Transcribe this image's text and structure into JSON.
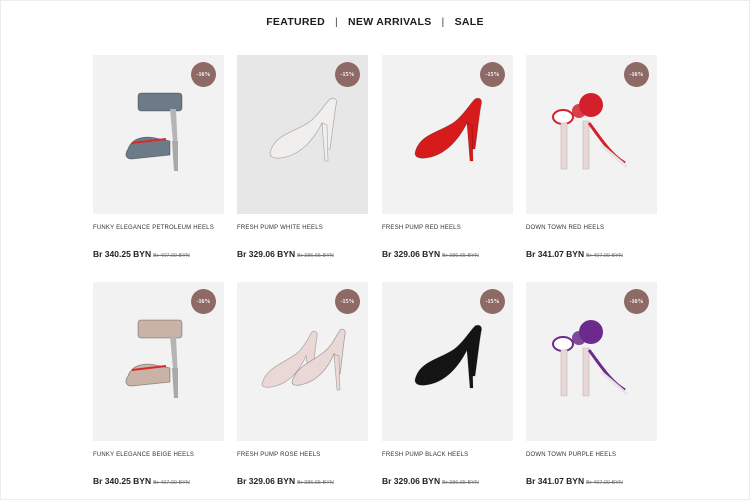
{
  "tabs": [
    "FEATURED",
    "NEW ARRIVALS",
    "SALE"
  ],
  "separator": "|",
  "products": [
    {
      "title": "FUNKY ELEGANCE PETROLEUM HEELS",
      "price": "Br 340.25 BYN",
      "old_price": "Br 407.00 BYN",
      "badge": "-16%",
      "color": "#6d7a88",
      "style": "funky"
    },
    {
      "title": "FRESH PUMP WHITE HEELS",
      "price": "Br 329.06 BYN",
      "old_price": "Br 386.65 BYN",
      "badge": "-15%",
      "color": "#f1eeee",
      "style": "pump"
    },
    {
      "title": "FRESH PUMP RED HEELS",
      "price": "Br 329.06 BYN",
      "old_price": "Br 386.65 BYN",
      "badge": "-15%",
      "color": "#d71b1b",
      "style": "pump"
    },
    {
      "title": "DOWN TOWN RED HEELS",
      "price": "Br 341.07 BYN",
      "old_price": "Br 407.00 BYN",
      "badge": "-16%",
      "color": "#d4202a",
      "style": "downtown"
    },
    {
      "title": "FUNKY ELEGANCE BEIGE HEELS",
      "price": "Br 340.25 BYN",
      "old_price": "Br 407.00 BYN",
      "badge": "-16%",
      "color": "#c9b2a6",
      "style": "funky"
    },
    {
      "title": "FRESH PUMP ROSE HEELS",
      "price": "Br 329.06 BYN",
      "old_price": "Br 386.65 BYN",
      "badge": "-15%",
      "color": "#ead8d7",
      "style": "pair"
    },
    {
      "title": "FRESH PUMP BLACK HEELS",
      "price": "Br 329.06 BYN",
      "old_price": "Br 386.65 BYN",
      "badge": "-15%",
      "color": "#141414",
      "style": "pump"
    },
    {
      "title": "DOWN TOWN PURPLE HEELS",
      "price": "Br 341.07 BYN",
      "old_price": "Br 407.00 BYN",
      "badge": "-16%",
      "color": "#6b2a8c",
      "style": "downtown"
    }
  ],
  "colors": {
    "badge": "#8e6a66",
    "card_bg": "#f2f2f2"
  }
}
